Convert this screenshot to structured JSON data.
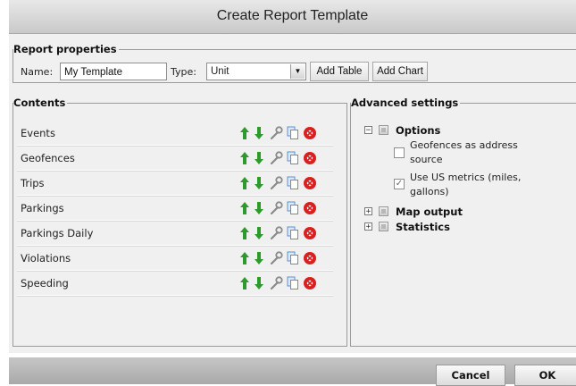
{
  "window": {
    "title": "Create Report Template"
  },
  "report_properties": {
    "legend": "Report properties",
    "name_label": "Name:",
    "name_value": "My Template",
    "type_label": "Type:",
    "type_value": "Unit",
    "add_table_label": "Add Table",
    "add_chart_label": "Add Chart"
  },
  "contents": {
    "legend": "Contents",
    "rows": [
      {
        "label": "Events"
      },
      {
        "label": "Geofences"
      },
      {
        "label": "Trips"
      },
      {
        "label": "Parkings"
      },
      {
        "label": "Parkings Daily"
      },
      {
        "label": "Violations"
      },
      {
        "label": "Speeding"
      }
    ],
    "row_actions": [
      "move-up-icon",
      "move-down-icon",
      "wrench-icon",
      "copy-icon",
      "delete-icon"
    ]
  },
  "advanced": {
    "legend": "Advanced settings",
    "options": {
      "label": "Options",
      "expanded": true,
      "items": [
        {
          "line1": "Geofences as address",
          "line2": "source",
          "checked": false
        },
        {
          "line1": "Use US metrics (miles,",
          "line2": "gallons)",
          "checked": true
        }
      ]
    },
    "map_output": {
      "label": "Map output",
      "expanded": false
    },
    "statistics": {
      "label": "Statistics",
      "expanded": false
    }
  },
  "footer": {
    "cancel_label": "Cancel",
    "ok_label": "OK"
  },
  "colors": {
    "arrow_green": "#2e9a2e",
    "delete_red": "#d82020",
    "copy_blue": "#5c8fd6"
  }
}
